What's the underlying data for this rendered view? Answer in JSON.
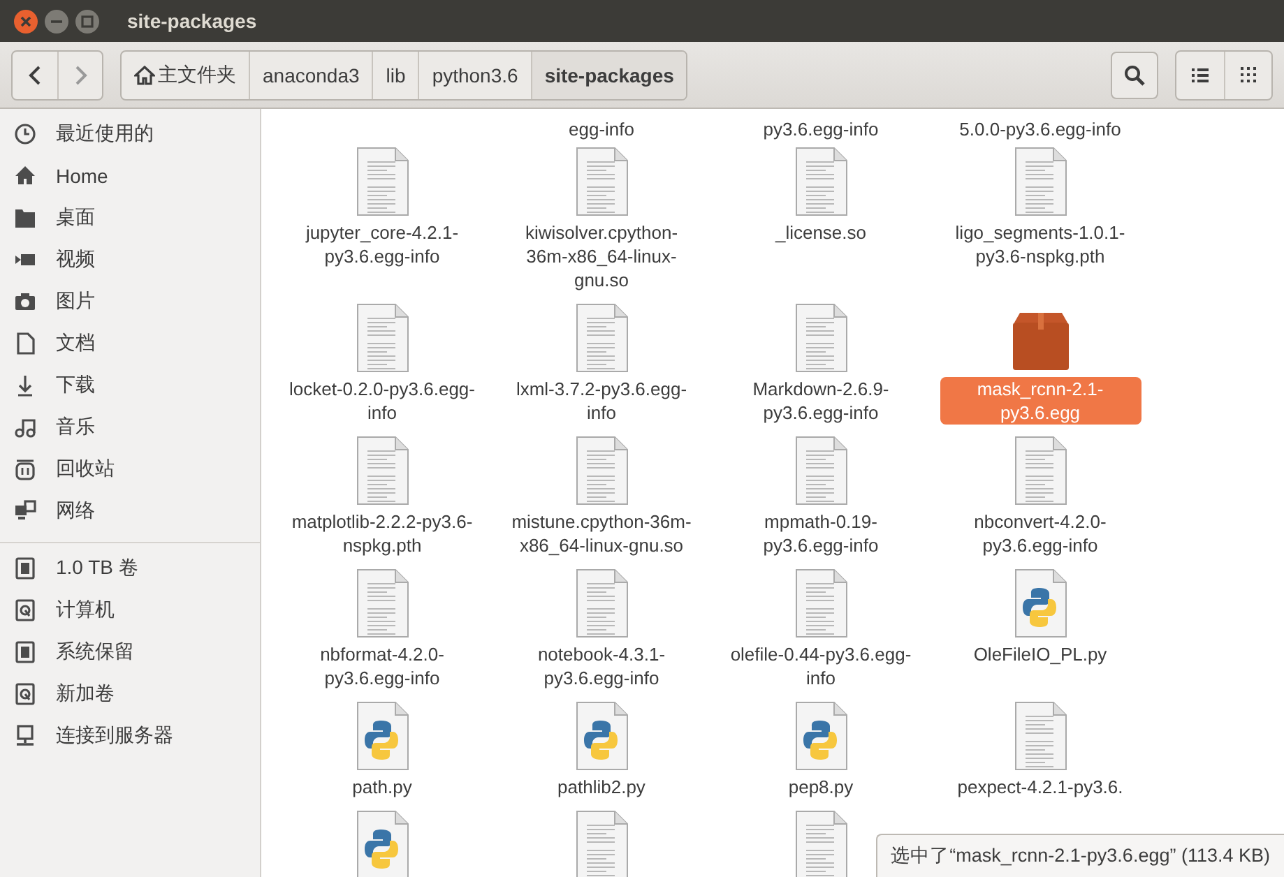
{
  "window": {
    "title": "site-packages"
  },
  "toolbar": {
    "breadcrumbs": [
      {
        "label": "主文件夹",
        "kind": "home",
        "selected": false
      },
      {
        "label": "anaconda3",
        "kind": "folder",
        "selected": false
      },
      {
        "label": "lib",
        "kind": "folder",
        "selected": false
      },
      {
        "label": "python3.6",
        "kind": "folder",
        "selected": false
      },
      {
        "label": "site-packages",
        "kind": "folder",
        "selected": true
      }
    ]
  },
  "sidebar": {
    "groups": [
      [
        {
          "label": "最近使用的",
          "kind": "recent"
        },
        {
          "label": "Home",
          "kind": "home"
        },
        {
          "label": "桌面",
          "kind": "folder"
        },
        {
          "label": "视频",
          "kind": "video"
        },
        {
          "label": "图片",
          "kind": "camera"
        },
        {
          "label": "文档",
          "kind": "document"
        },
        {
          "label": "下载",
          "kind": "download"
        },
        {
          "label": "音乐",
          "kind": "music"
        },
        {
          "label": "回收站",
          "kind": "trash"
        },
        {
          "label": "网络",
          "kind": "network"
        }
      ],
      [
        {
          "label": "1.0 TB 卷",
          "kind": "chip"
        },
        {
          "label": "计算机",
          "kind": "disk"
        },
        {
          "label": "系统保留",
          "kind": "chip"
        },
        {
          "label": "新加卷",
          "kind": "disk"
        },
        {
          "label": "连接到服务器",
          "kind": "server"
        }
      ]
    ]
  },
  "files": {
    "cut_top_labels": [
      "egg-info",
      "py3.6.egg-info",
      "5.0.0-py3.6.egg-info"
    ],
    "items": [
      {
        "name": "jupyter_core-4.2.1-py3.6.egg-info",
        "kind": "document",
        "selected": false
      },
      {
        "name": "kiwisolver.cpython-36m-x86_64-linux-gnu.so",
        "kind": "document",
        "selected": false
      },
      {
        "name": "_license.so",
        "kind": "document",
        "selected": false
      },
      {
        "name": "ligo_segments-1.0.1-py3.6-nspkg.pth",
        "kind": "document",
        "selected": false
      },
      {
        "name": "locket-0.2.0-py3.6.egg-info",
        "kind": "document",
        "selected": false
      },
      {
        "name": "lxml-3.7.2-py3.6.egg-info",
        "kind": "document",
        "selected": false
      },
      {
        "name": "Markdown-2.6.9-py3.6.egg-info",
        "kind": "document",
        "selected": false
      },
      {
        "name": "mask_rcnn-2.1-py3.6.egg",
        "kind": "zip",
        "selected": true
      },
      {
        "name": "matplotlib-2.2.2-py3.6-nspkg.pth",
        "kind": "document",
        "selected": false
      },
      {
        "name": "mistune.cpython-36m-x86_64-linux-gnu.so",
        "kind": "document",
        "selected": false
      },
      {
        "name": "mpmath-0.19-py3.6.egg-info",
        "kind": "document",
        "selected": false
      },
      {
        "name": "nbconvert-4.2.0-py3.6.egg-info",
        "kind": "document",
        "selected": false
      },
      {
        "name": "nbformat-4.2.0-py3.6.egg-info",
        "kind": "document",
        "selected": false
      },
      {
        "name": "notebook-4.3.1-py3.6.egg-info",
        "kind": "document",
        "selected": false
      },
      {
        "name": "olefile-0.44-py3.6.egg-info",
        "kind": "document",
        "selected": false
      },
      {
        "name": "OleFileIO_PL.py",
        "kind": "python",
        "selected": false
      },
      {
        "name": "path.py",
        "kind": "python",
        "selected": false
      },
      {
        "name": "pathlib2.py",
        "kind": "python",
        "selected": false
      },
      {
        "name": "pep8.py",
        "kind": "python",
        "selected": false
      },
      {
        "name": "pexpect-4.2.1-py3.6.",
        "kind": "document",
        "selected": false
      }
    ],
    "cut_bottom_items": [
      {
        "kind": "python"
      },
      {
        "kind": "document"
      },
      {
        "kind": "document"
      }
    ]
  },
  "status": {
    "text": "选中了“mask_rcnn-2.1-py3.6.egg” (113.4 KB)"
  }
}
